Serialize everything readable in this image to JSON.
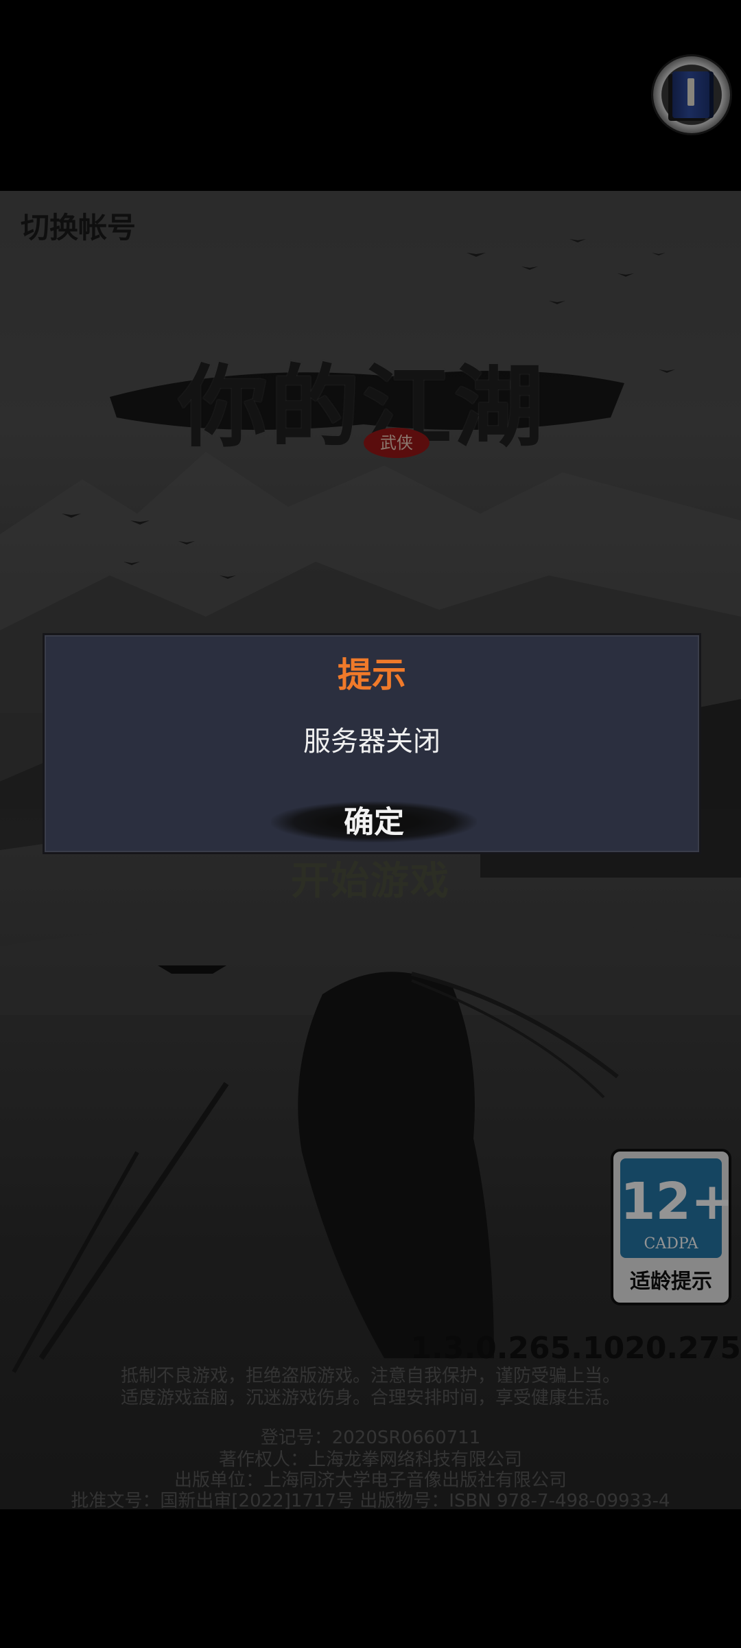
{
  "header": {
    "switch_account_label": "切换帐号"
  },
  "logo": {
    "title": "你的江湖",
    "seal": "武侠"
  },
  "main": {
    "start_label": "开始游戏",
    "version": "1.3.0.265.1020.275"
  },
  "age_rating": {
    "number": "12+",
    "org": "CADPA",
    "label": "适龄提示"
  },
  "legal": {
    "notice_line1": "抵制不良游戏，拒绝盗版游戏。注意自我保护，谨防受骗上当。",
    "notice_line2": "适度游戏益脑，沉迷游戏伤身。合理安排时间，享受健康生活。",
    "reg_no": "登记号：2020SR0660711",
    "copyright": "著作权人：上海龙拳网络科技有限公司",
    "publisher": "出版单位：上海同济大学电子音像出版社有限公司",
    "approval": "批准文号：国新出审[2022]1717号 出版物号：ISBN 978-7-498-09933-4"
  },
  "dialog": {
    "title": "提示",
    "message": "服务器关闭",
    "ok_label": "确定"
  },
  "colors": {
    "dialog_title": "#f07a2a",
    "dialog_bg": "#2b2f3f",
    "age_badge_blue": "#2577a8"
  },
  "icons": {
    "top_right": "book-icon"
  }
}
